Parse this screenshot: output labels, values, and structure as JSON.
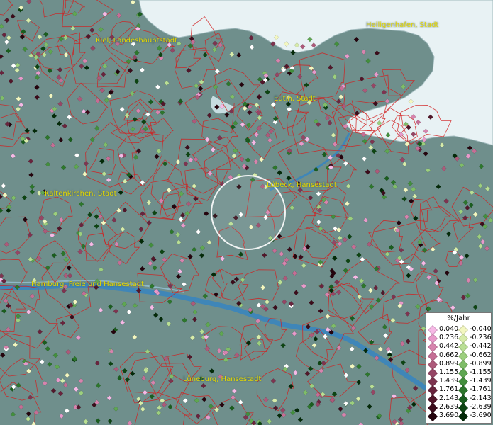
{
  "map": {
    "cities": [
      {
        "name": "Heiligenhafen, Stadt"
      },
      {
        "name": "Kiel, Landeshauptstadt"
      },
      {
        "name": "Eutin, Stadt"
      },
      {
        "name": "Lübeck, Hansestadt"
      },
      {
        "name": "Kaltenkirchen, Stadt"
      },
      {
        "name": "Hamburg, Freie und Hansestadt"
      },
      {
        "name": "Lüneburg, Hansestadt"
      }
    ],
    "colors": {
      "land": "#6f8f8c",
      "water": "#e8f2f4",
      "river": "#3f86b8",
      "boundary": "#d21e1e",
      "label": "#e6d800",
      "highlight_circle": "#ffffff"
    }
  },
  "legend": {
    "title": "%/Jahr",
    "positive": [
      {
        "label": "0.040",
        "color": "#f6b9e6"
      },
      {
        "label": "0.236",
        "color": "#e89acb"
      },
      {
        "label": "0.442",
        "color": "#d784ae"
      },
      {
        "label": "0.662",
        "color": "#c56e95"
      },
      {
        "label": "0.899",
        "color": "#ad5a7a"
      },
      {
        "label": "1.155",
        "color": "#964665"
      },
      {
        "label": "1.439",
        "color": "#7e3450"
      },
      {
        "label": "1.761",
        "color": "#69243d"
      },
      {
        "label": "2.143",
        "color": "#52172a"
      },
      {
        "label": "2.639",
        "color": "#3c0c1b"
      },
      {
        "label": "3.690",
        "color": "#25040d"
      }
    ],
    "negative": [
      {
        "label": "-0.040",
        "color": "#f3f7c0"
      },
      {
        "label": "-0.236",
        "color": "#d7ecaa"
      },
      {
        "label": "-0.442",
        "color": "#b9df94"
      },
      {
        "label": "-0.662",
        "color": "#9ccf7e"
      },
      {
        "label": "-0.899",
        "color": "#7fbd69"
      },
      {
        "label": "-1.155",
        "color": "#5fa752"
      },
      {
        "label": "-1.439",
        "color": "#438f3d"
      },
      {
        "label": "-1.761",
        "color": "#2d772c"
      },
      {
        "label": "-2.143",
        "color": "#1a5e1e"
      },
      {
        "label": "-2.639",
        "color": "#0d4512"
      },
      {
        "label": "-3.690",
        "color": "#032a08"
      }
    ]
  }
}
